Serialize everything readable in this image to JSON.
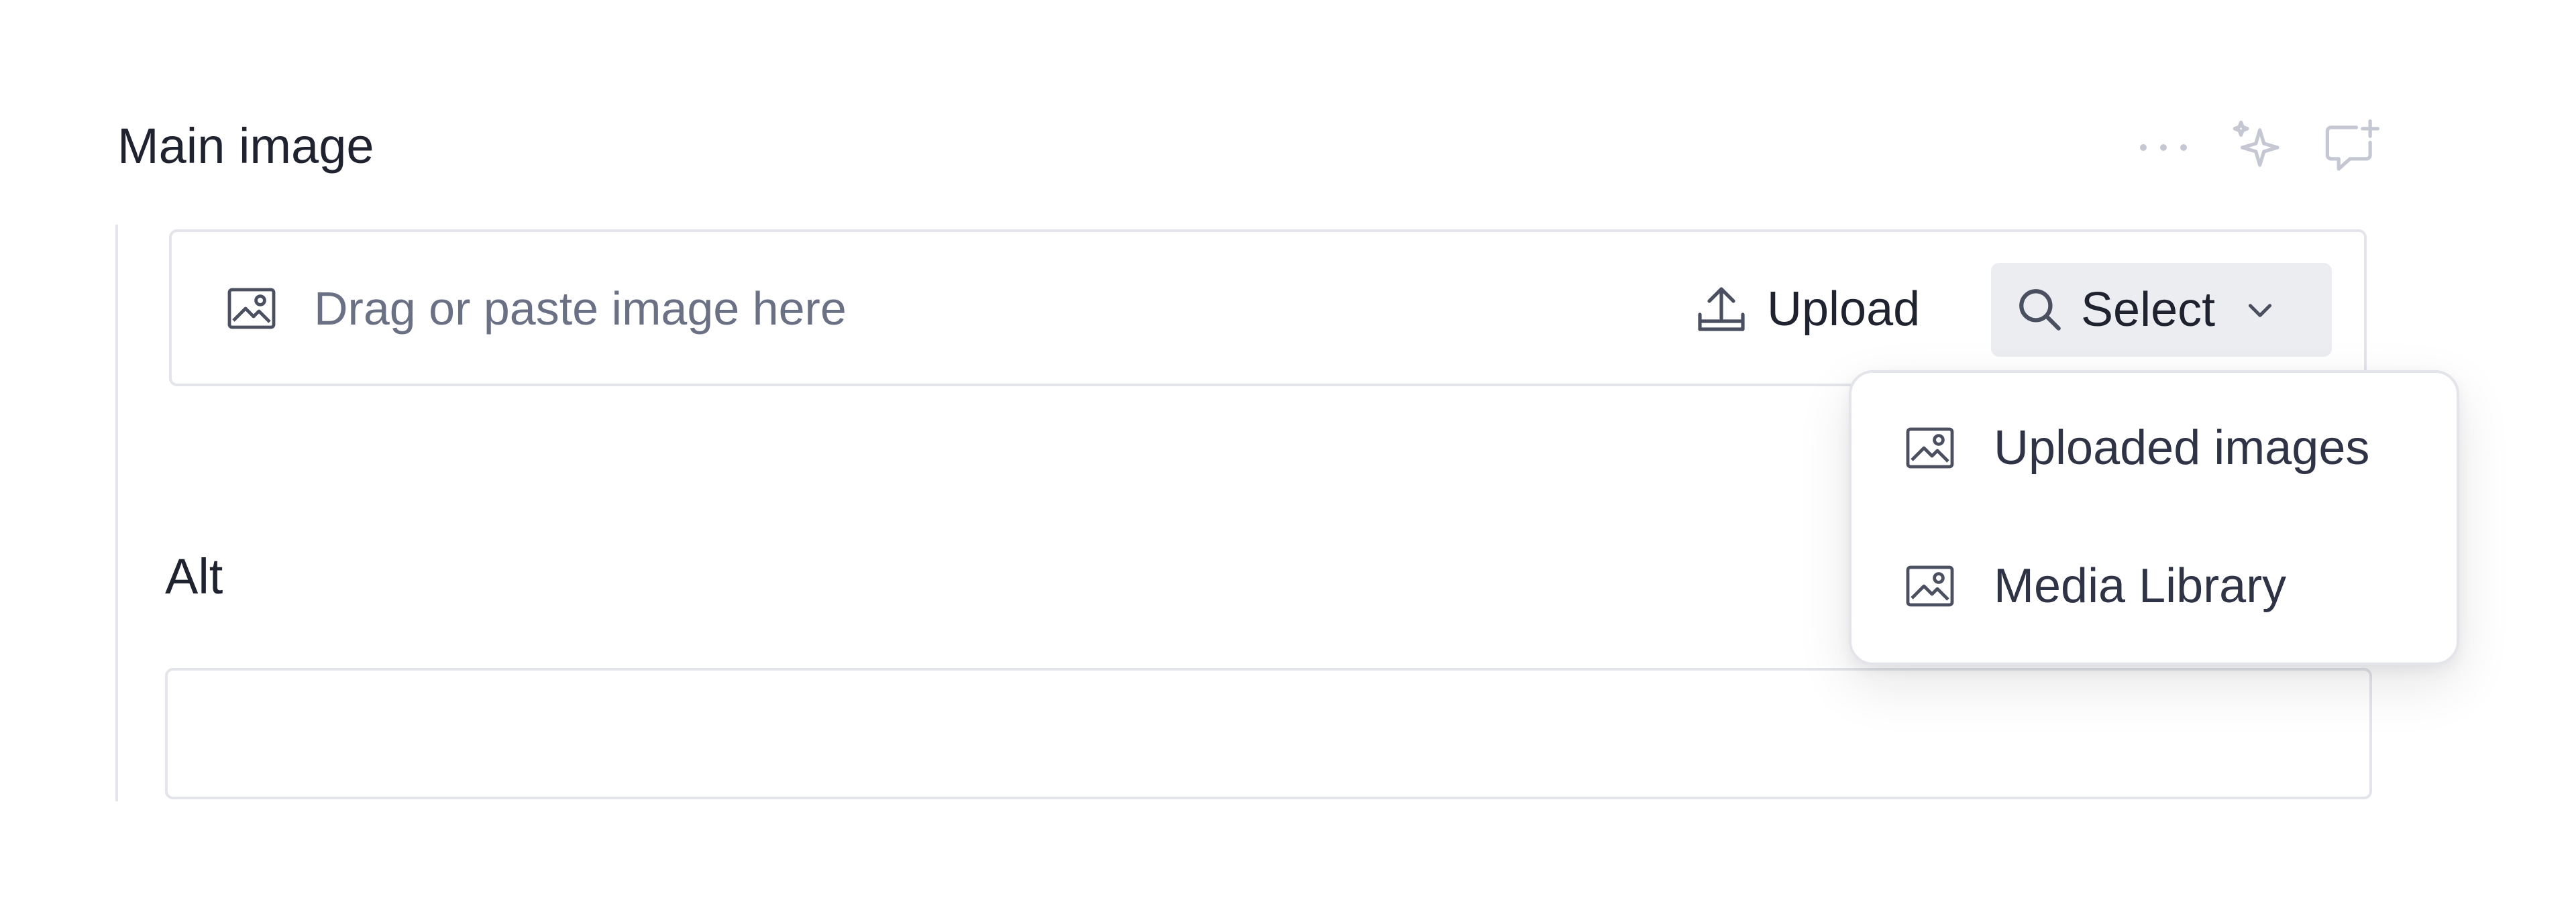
{
  "field": {
    "title": "Main image"
  },
  "title_actions": {
    "more_icon": "more-horizontal-icon",
    "ai_icon": "sparkles-icon",
    "comment_icon": "add-comment-icon"
  },
  "dropzone": {
    "icon": "image-icon",
    "placeholder": "Drag or paste image here",
    "upload_label": "Upload",
    "select_label": "Select"
  },
  "alt": {
    "label": "Alt",
    "value": ""
  },
  "select_menu": {
    "items": [
      {
        "label": "Uploaded images",
        "icon": "image-icon"
      },
      {
        "label": "Media Library",
        "icon": "image-icon"
      }
    ]
  },
  "colors": {
    "text_primary": "#1f2330",
    "text_muted": "#6b7185",
    "border": "#e3e5ea",
    "button_bg": "#ecedf1",
    "action_icon": "#c5c8d2"
  }
}
